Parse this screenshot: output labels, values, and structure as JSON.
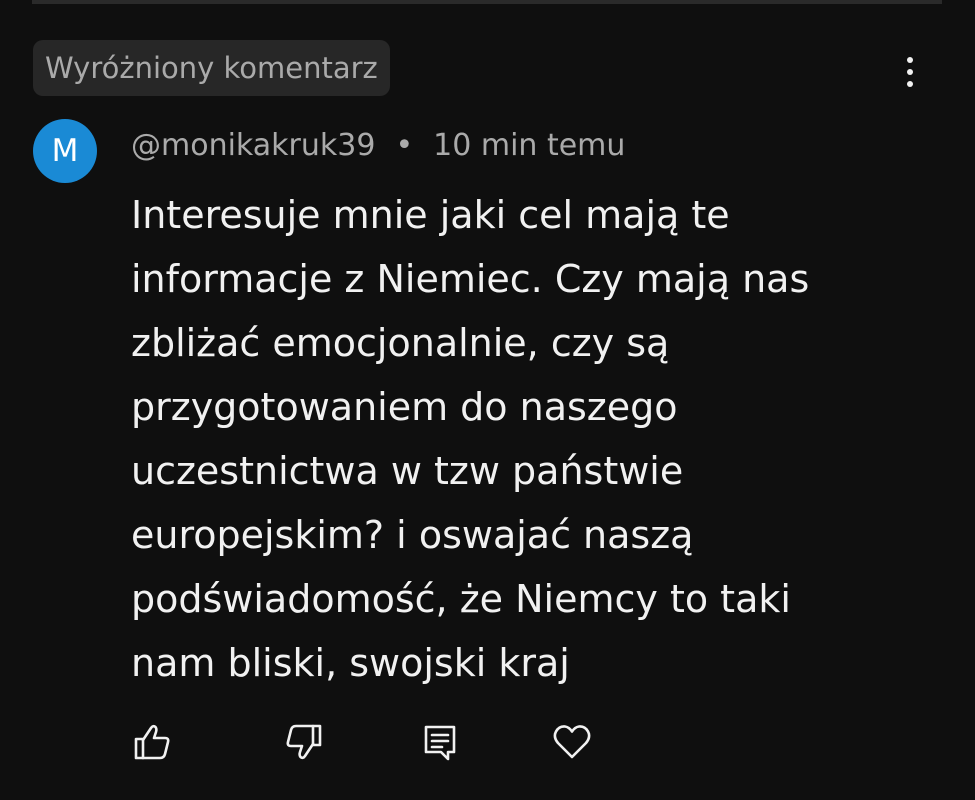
{
  "comment": {
    "badge": "Wyróżniony komentarz",
    "avatar_letter": "M",
    "avatar_color": "#1a8ad5",
    "author": "@monikakruk39",
    "separator": "•",
    "time": "10 min temu",
    "text": "Interesuje mnie jaki cel mają te\ninformacje z Niemiec. Czy mają nas\nzbliżać emocjonalnie, czy są\nprzygotowaniem do naszego\nuczestnictwa w tzw państwie\neuropejskim?  i oswajać naszą\npodświadomość, że Niemcy to taki\nnam bliski, swojski kraj"
  },
  "icons": {
    "more": "more-vertical-icon",
    "like": "thumbs-up-icon",
    "dislike": "thumbs-down-icon",
    "reply": "reply-icon",
    "heart": "heart-icon"
  },
  "colors": {
    "background": "#0f0f0f",
    "text": "#f1f1f1",
    "muted": "#aaaaaa",
    "badge_bg": "#272727"
  }
}
